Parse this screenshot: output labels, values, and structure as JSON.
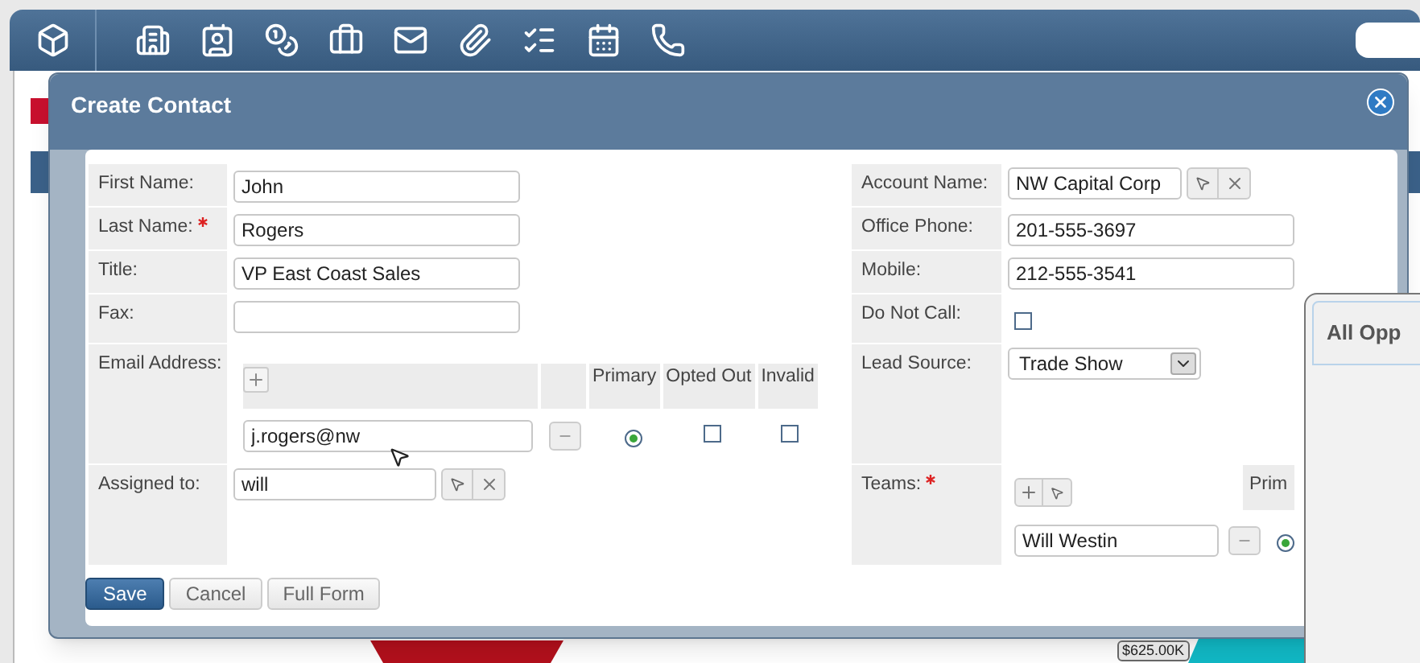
{
  "background": {
    "chart_label": "$625.00K",
    "panel_title": "All Opp"
  },
  "dialog": {
    "title": "Create Contact",
    "left_fields": [
      {
        "label": "First Name:",
        "required": false,
        "kind": "text",
        "value": "John"
      },
      {
        "label": "Last Name:",
        "required": true,
        "kind": "text",
        "value": "Rogers"
      },
      {
        "label": "Title:",
        "required": false,
        "kind": "text",
        "value": "VP East Coast Sales"
      },
      {
        "label": "Fax:",
        "required": false,
        "kind": "text"
      },
      {
        "label": "Email Address:",
        "required": false,
        "kind": "email",
        "columns": [
          "Primary",
          "Opted Out",
          "Invalid"
        ],
        "rows": [
          {
            "value": "j.rogers@nw",
            "primary": true,
            "opted_out": false,
            "invalid": false
          }
        ]
      },
      {
        "label": "Assigned to:",
        "required": false,
        "kind": "relate",
        "value": "will"
      }
    ],
    "right_fields": [
      {
        "label": "Account Name:",
        "required": false,
        "kind": "relate",
        "value": "NW Capital Corp"
      },
      {
        "label": "Office Phone:",
        "required": false,
        "kind": "text",
        "value": "201-555-3697"
      },
      {
        "label": "Mobile:",
        "required": false,
        "kind": "text",
        "value": "212-555-3541"
      },
      {
        "label": "Do Not Call:",
        "required": false,
        "kind": "checkbox",
        "checked": false
      },
      {
        "label": "Lead Source:",
        "required": false,
        "kind": "select",
        "value": "Trade Show"
      },
      {
        "label": "Teams:",
        "required": true,
        "kind": "teams",
        "column": "Prim",
        "rows": [
          {
            "value": "Will Westin",
            "primary": true
          }
        ]
      }
    ],
    "buttons": [
      {
        "label": "Save",
        "kind": "primary"
      },
      {
        "label": "Cancel",
        "kind": "default"
      },
      {
        "label": "Full Form",
        "kind": "default"
      }
    ]
  }
}
